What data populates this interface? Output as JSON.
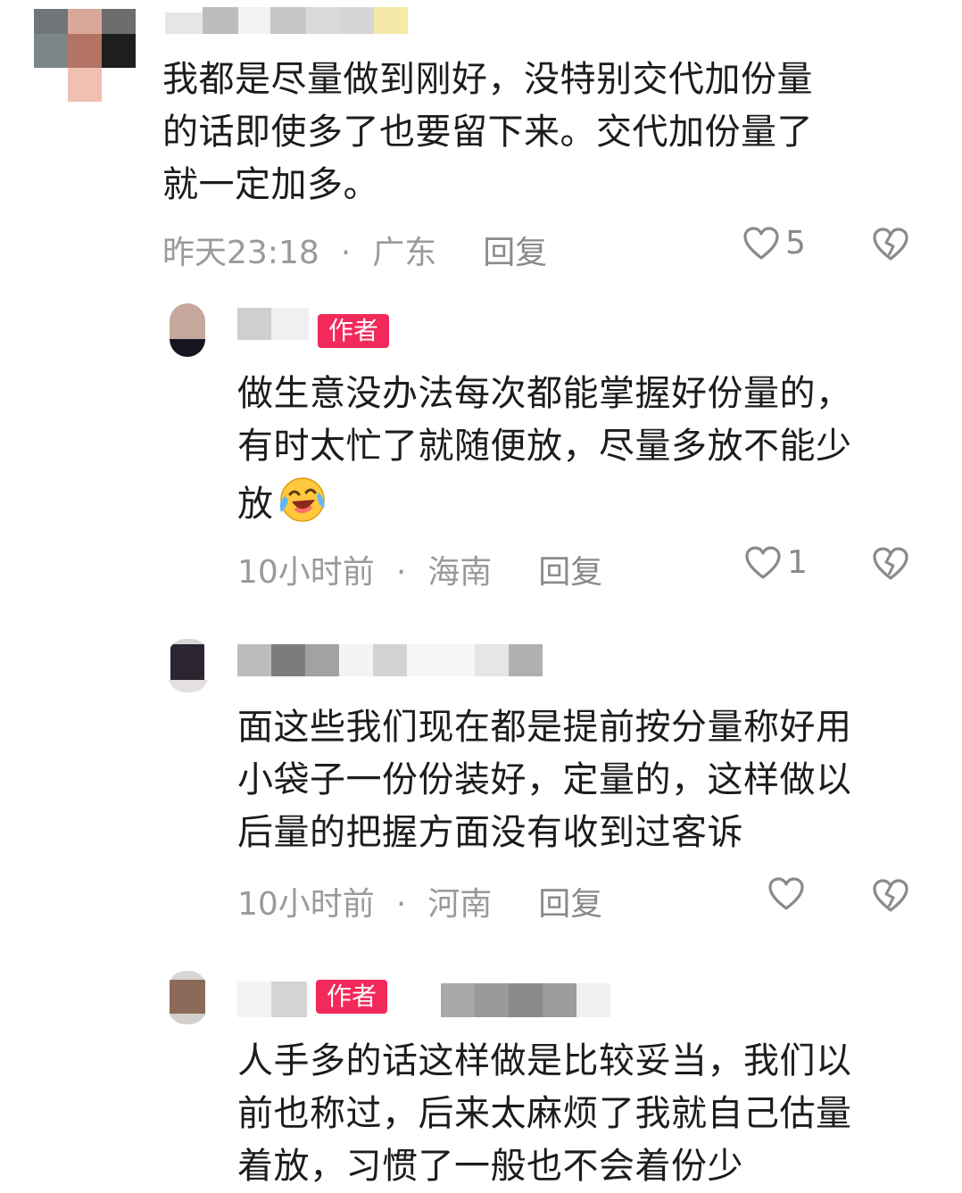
{
  "comments": [
    {
      "lines": [
        "我都是尽量做到刚好，没特别交代加份量",
        "的话即使多了也要留下来。交代加份量了",
        "就一定加多。"
      ],
      "time": "昨天23:18",
      "location": "广东",
      "reply_label": "回复",
      "likes": "5"
    },
    {
      "badge": "作者",
      "lines": [
        "做生意没办法每次都能掌握好份量的，",
        "有时太忙了就随便放，尽量多放不能少",
        "放"
      ],
      "time": "10小时前",
      "location": "海南",
      "reply_label": "回复",
      "likes": "1"
    },
    {
      "lines": [
        "面这些我们现在都是提前按分量称好用",
        "小袋子一份份装好，定量的，这样做以",
        "后量的把握方面没有收到过客诉"
      ],
      "time": "10小时前",
      "location": "河南",
      "reply_label": "回复",
      "likes": ""
    },
    {
      "badge": "作者",
      "lines": [
        "人手多的话这样做是比较妥当，我们以",
        "前也称过，后来太麻烦了我就自己估量",
        "着放，习惯了一般也不会着份少"
      ]
    }
  ],
  "separator": "·",
  "colors": {
    "badge": "#f2295a",
    "meta": "#9a9a9a",
    "text": "#1c1c1c"
  },
  "icons": {
    "like": "heart-outline-icon",
    "dislike": "broken-heart-icon",
    "emoji": "laughing-crying-emoji-icon"
  }
}
